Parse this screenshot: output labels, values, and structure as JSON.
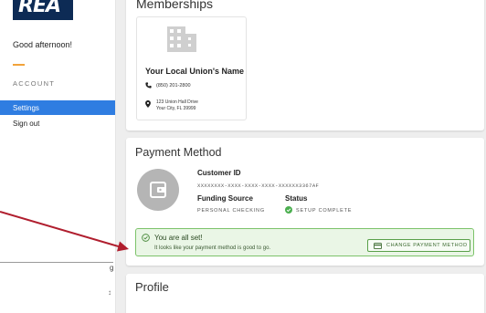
{
  "sidebar": {
    "logo_text": "REA",
    "greeting": "Good afternoon!",
    "section_label": "ACCOUNT",
    "nav": {
      "settings": "Settings",
      "sign_out": "Sign out"
    }
  },
  "memberships": {
    "title": "Memberships",
    "union": {
      "name": "Your Local Union's Name",
      "phone": "(850) 201-2800",
      "address_line1": "123 Union Hall Drive",
      "address_line2": "Your City, FL 39999"
    }
  },
  "payment": {
    "title": "Payment Method",
    "customer_id_label": "Customer ID",
    "customer_id_value": "XXXXXXXX-XXXX-XXXX-XXXX-XXXXXX3367AF",
    "funding_source_label": "Funding Source",
    "funding_source_value": "PERSONAL CHECKING",
    "status_label": "Status",
    "status_value": "SETUP COMPLETE",
    "success_title": "You are all set!",
    "success_text": "It looks like your payment method is good to go.",
    "change_button": "CHANGE PAYMENT METHOD"
  },
  "profile": {
    "title": "Profile"
  },
  "stray": {
    "text": "g",
    "mark": "↕"
  },
  "colors": {
    "accent_blue": "#2f7de1",
    "accent_orange": "#f2a33a",
    "success_green": "#7cc36a",
    "annotation_red": "#b01e2e",
    "logo_navy": "#0d2b55"
  }
}
